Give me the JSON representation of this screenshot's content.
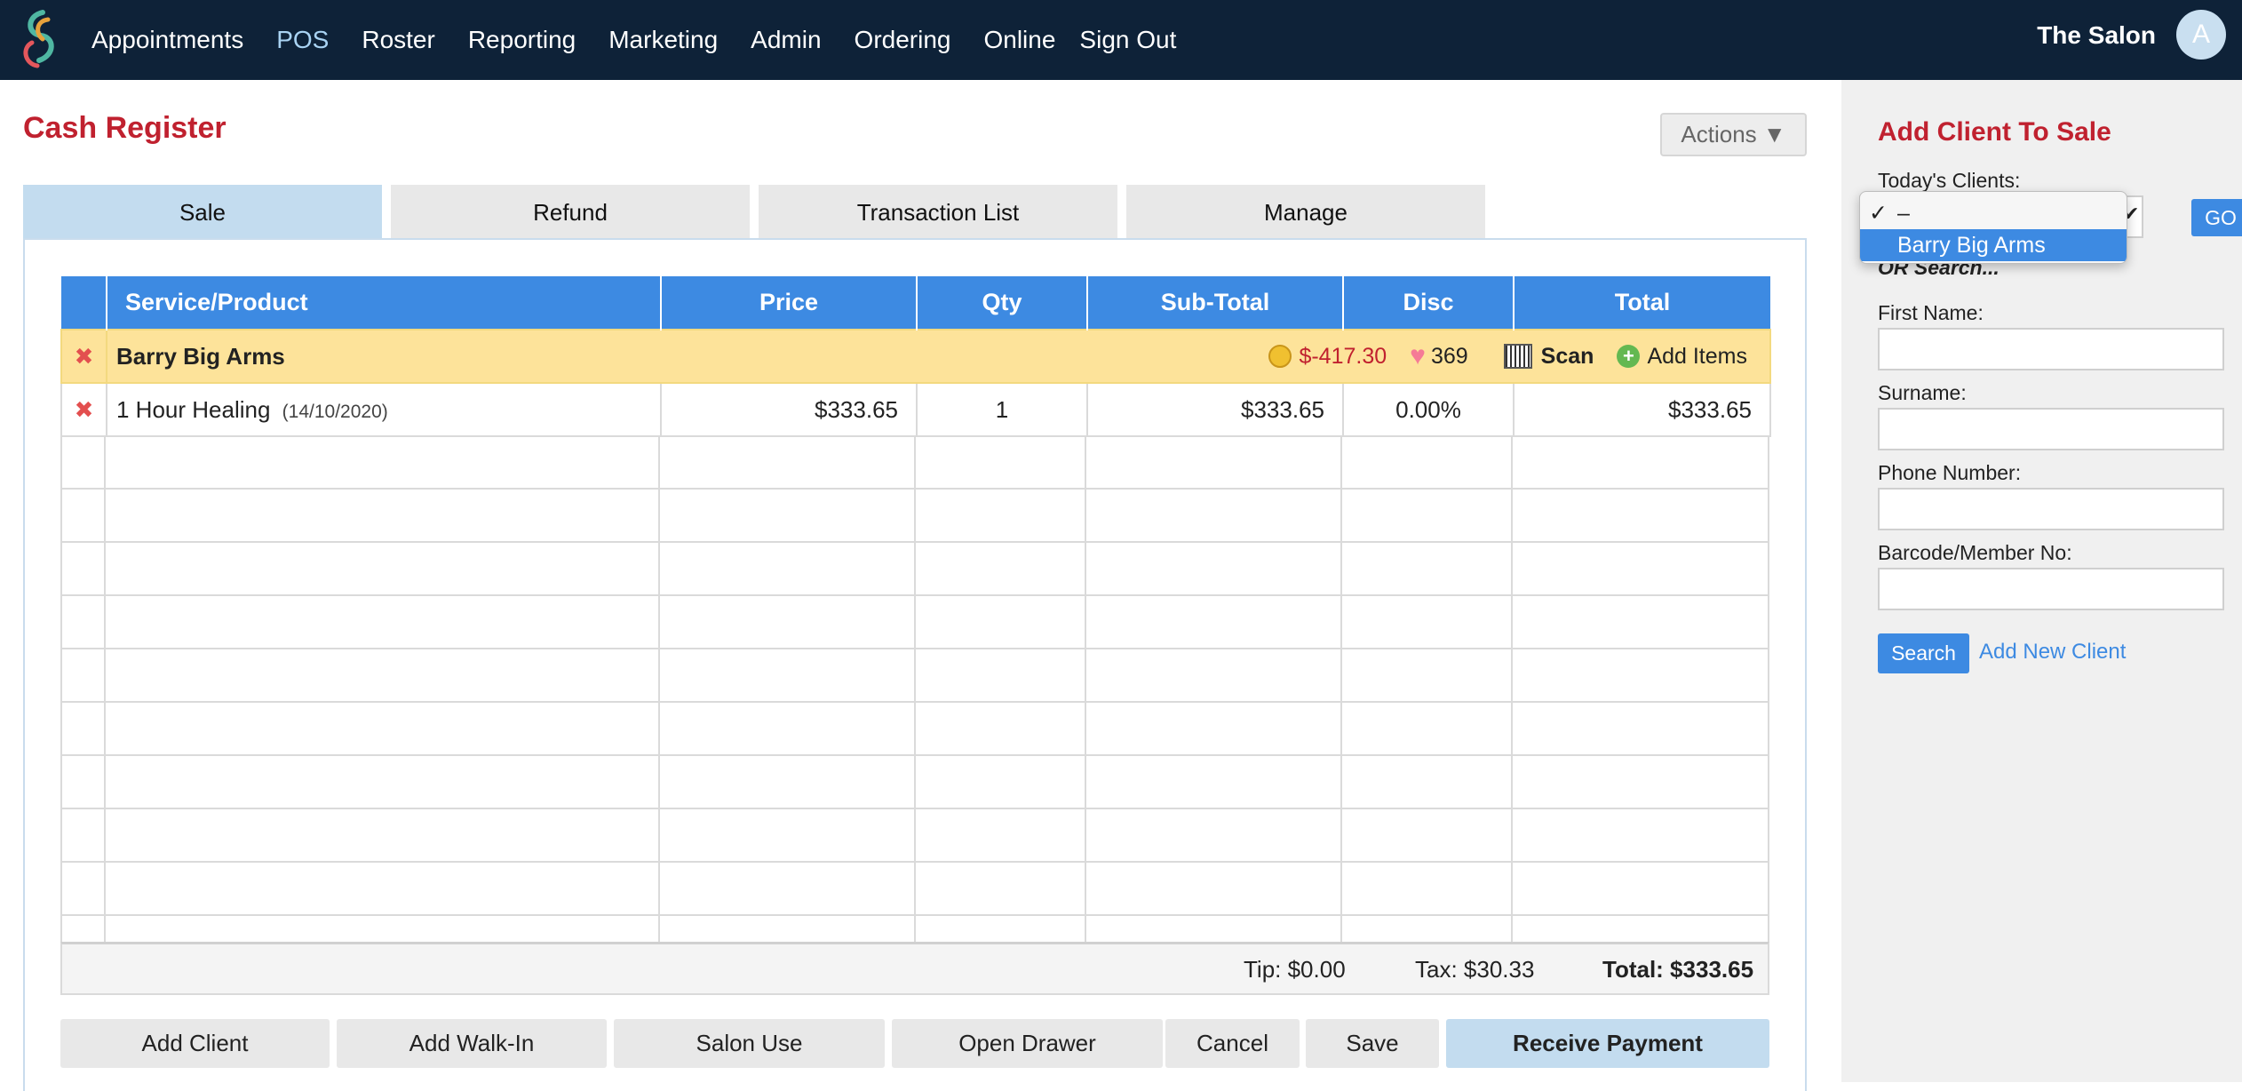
{
  "nav": {
    "items": [
      "Appointments",
      "POS",
      "Roster",
      "Reporting",
      "Marketing",
      "Admin",
      "Ordering",
      "Online",
      "Sign Out"
    ],
    "active": "POS",
    "salon_name": "The Salon",
    "avatar_initial": "A"
  },
  "page": {
    "title": "Cash Register",
    "actions_label": "Actions ▼"
  },
  "tabs": [
    {
      "label": "Sale",
      "active": true
    },
    {
      "label": "Refund",
      "active": false
    },
    {
      "label": "Transaction List",
      "active": false
    },
    {
      "label": "Manage",
      "active": false
    }
  ],
  "table": {
    "headers": {
      "product": "Service/Product",
      "price": "Price",
      "qty": "Qty",
      "subtotal": "Sub-Total",
      "disc": "Disc",
      "total": "Total"
    },
    "client_row": {
      "name": "Barry Big Arms",
      "balance": "$-417.30",
      "points": "369",
      "scan_label": "Scan",
      "add_items_label": "Add Items"
    },
    "items": [
      {
        "name": "1 Hour Healing",
        "date": "(14/10/2020)",
        "price": "$333.65",
        "qty": "1",
        "subtotal": "$333.65",
        "disc": "0.00%",
        "total": "$333.65"
      }
    ]
  },
  "totals": {
    "tip": "Tip: $0.00",
    "tax": "Tax: $30.33",
    "total": "Total: $333.65"
  },
  "buttons": {
    "add_client": "Add Client",
    "add_walkin": "Add Walk-In",
    "salon_use": "Salon Use",
    "open_drawer": "Open Drawer",
    "cancel": "Cancel",
    "save": "Save",
    "receive_payment": "Receive Payment"
  },
  "sidebar": {
    "title": "Add Client To Sale",
    "todays_clients_label": "Today's Clients:",
    "go_label": "GO",
    "or_search": "OR Search...",
    "first_name_label": "First Name:",
    "surname_label": "Surname:",
    "phone_label": "Phone Number:",
    "barcode_label": "Barcode/Member No:",
    "search_label": "Search",
    "add_new_client_label": "Add New Client",
    "dropdown": {
      "options": [
        "–",
        "Barry Big Arms"
      ],
      "checked_index": 0,
      "highlighted_index": 1
    }
  },
  "colors": {
    "nav_bg": "#0e2238",
    "accent_red": "#c0212f",
    "header_blue": "#3d8ae2",
    "client_row_yellow": "#fde39a",
    "active_tab": "#c3dcef"
  }
}
